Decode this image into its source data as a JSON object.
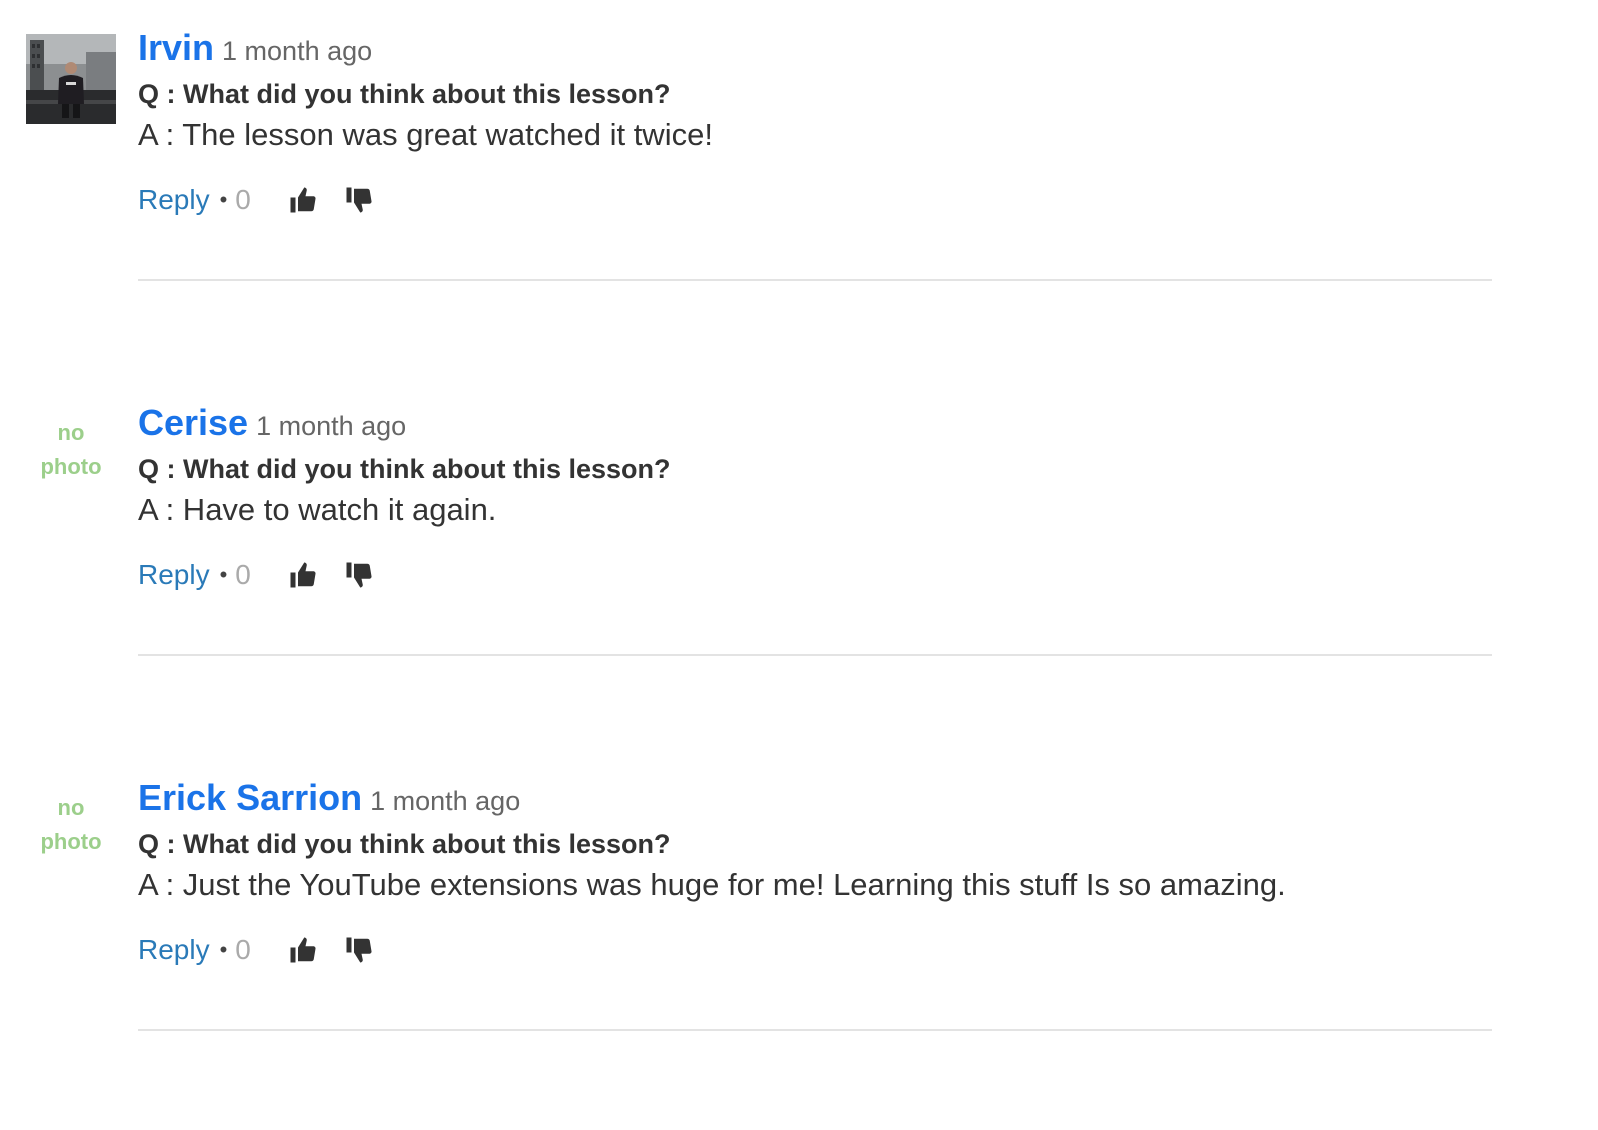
{
  "comments": [
    {
      "author": "Irvin",
      "time": "1 month ago",
      "question": "Q : What did you think about this lesson?",
      "answer": "A : The lesson was great watched it twice!",
      "reply_label": "Reply",
      "separator": "•",
      "score": "0",
      "has_photo": true
    },
    {
      "author": "Cerise",
      "time": "1 month ago",
      "question": "Q : What did you think about this lesson?",
      "answer": "A : Have to watch it again.",
      "reply_label": "Reply",
      "separator": "•",
      "score": "0",
      "has_photo": false,
      "no_photo_line1": "no",
      "no_photo_line2": "photo"
    },
    {
      "author": "Erick Sarrion",
      "time": "1 month ago",
      "question": "Q : What did you think about this lesson?",
      "answer": "A : Just the YouTube extensions was huge for me! Learning this stuff Is so amazing.",
      "reply_label": "Reply",
      "separator": "•",
      "score": "0",
      "has_photo": false,
      "no_photo_line1": "no",
      "no_photo_line2": "photo"
    }
  ],
  "colors": {
    "author": "#1a73e8",
    "reply": "#2a7ab8",
    "no_photo": "#9ccf8b",
    "divider": "#e3e3e3",
    "vote_icon": "#333333"
  },
  "icons": {
    "upvote": "thumbs-up-icon",
    "downvote": "thumbs-down-icon"
  }
}
